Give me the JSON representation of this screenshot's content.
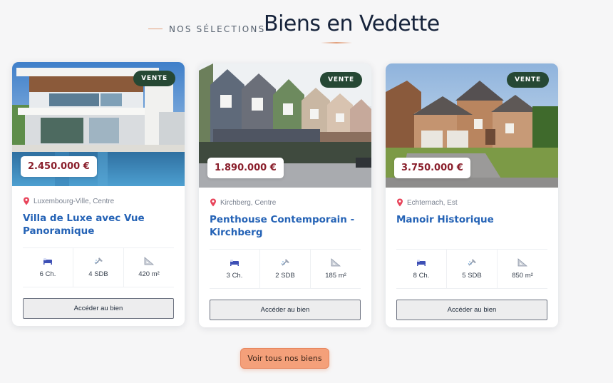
{
  "section": {
    "eyebrow": "NOS SÉLECTIONS",
    "title": "Biens en Vedette"
  },
  "properties": [
    {
      "badge": "VENTE",
      "price": "2.450.000 €",
      "location": "Luxembourg-Ville, Centre",
      "title": "Villa de Luxe avec Vue Panoramique",
      "bedrooms": "6 Ch.",
      "bathrooms": "4 SDB",
      "area": "420 m²",
      "cta": "Accéder au bien"
    },
    {
      "badge": "VENTE",
      "price": "1.890.000 €",
      "location": "Kirchberg, Centre",
      "title": "Penthouse Contemporain - Kirchberg",
      "bedrooms": "3 Ch.",
      "bathrooms": "2 SDB",
      "area": "185 m²",
      "cta": "Accéder au bien"
    },
    {
      "badge": "VENTE",
      "price": "3.750.000 €",
      "location": "Echternach, Est",
      "title": "Manoir Historique",
      "bedrooms": "8 Ch.",
      "bathrooms": "5 SDB",
      "area": "850 m²",
      "cta": "Accéder au bien"
    }
  ],
  "view_all": "Voir tous nos biens",
  "icons": {
    "location": "map-pin-icon",
    "bedrooms": "bed-icon",
    "bathrooms": "shower-icon",
    "area": "ruler-triangle-icon"
  },
  "colors": {
    "accent": "#f4a07a",
    "badge": "#264834",
    "price": "#8a1f2c",
    "title_link": "#2563b6"
  }
}
